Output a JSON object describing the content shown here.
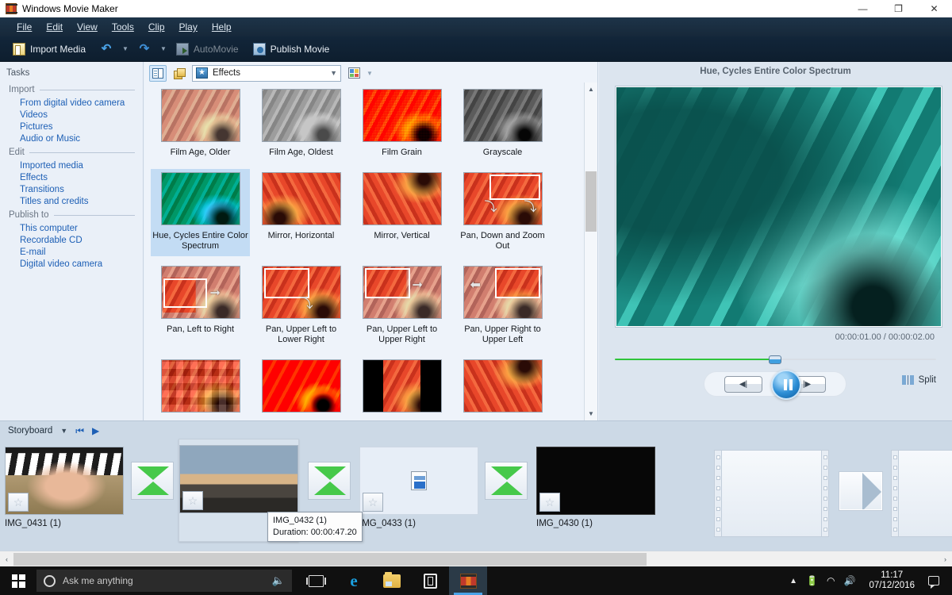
{
  "window": {
    "title": "Windows Movie Maker",
    "app_icon": "film-strip-icon",
    "minimize": "—",
    "maximize": "❐",
    "close": "✕"
  },
  "menu": {
    "items": [
      {
        "label": "File",
        "accel": "F"
      },
      {
        "label": "Edit",
        "accel": "E"
      },
      {
        "label": "View",
        "accel": "V"
      },
      {
        "label": "Tools",
        "accel": "T"
      },
      {
        "label": "Clip",
        "accel": "C"
      },
      {
        "label": "Play",
        "accel": "P"
      },
      {
        "label": "Help",
        "accel": "H"
      }
    ]
  },
  "toolbar": {
    "import_media": "Import Media",
    "undo": "↶",
    "redo": "↷",
    "automovie": "AutoMovie",
    "publish_movie": "Publish Movie"
  },
  "tasks": {
    "title": "Tasks",
    "groups": [
      {
        "heading": "Import",
        "links": [
          "From digital video camera",
          "Videos",
          "Pictures",
          "Audio or Music"
        ]
      },
      {
        "heading": "Edit",
        "links": [
          "Imported media",
          "Effects",
          "Transitions",
          "Titles and credits"
        ]
      },
      {
        "heading": "Publish to",
        "links": [
          "This computer",
          "Recordable CD",
          "E-mail",
          "Digital video camera"
        ]
      }
    ]
  },
  "effects_panel": {
    "collections_button": "collections-icon",
    "tasks_button": "tasks-pane-icon",
    "collection_selected": "Effects",
    "views_button": "views-icon",
    "items": [
      {
        "label": "Film Age, Older",
        "thumb": "fl-older",
        "selected": false
      },
      {
        "label": "Film Age, Oldest",
        "thumb": "fl-oldest",
        "selected": false
      },
      {
        "label": "Film Grain",
        "thumb": "fl-grain",
        "selected": false
      },
      {
        "label": "Grayscale",
        "thumb": "fl-gray",
        "selected": false
      },
      {
        "label": "Hue, Cycles Entire Color Spectrum",
        "thumb": "fl-hue",
        "selected": true
      },
      {
        "label": "Mirror, Horizontal",
        "thumb": "fl-mirrorh",
        "selected": false
      },
      {
        "label": "Mirror, Vertical",
        "thumb": "fl-mirrorv",
        "selected": false
      },
      {
        "label": "Pan, Down and Zoom Out",
        "thumb": "pan-down-zoom-out",
        "selected": false
      },
      {
        "label": "Pan, Left to Right",
        "thumb": "pan-left-right",
        "selected": false
      },
      {
        "label": "Pan, Upper Left to Lower Right",
        "thumb": "pan-ul-lr",
        "selected": false
      },
      {
        "label": "Pan, Upper Left to Upper Right",
        "thumb": "pan-ul-ur",
        "selected": false
      },
      {
        "label": "Pan, Upper Right to Upper Left",
        "thumb": "pan-ur-ul",
        "selected": false
      }
    ],
    "partial_row": [
      "fl-pixel",
      "fl-post",
      "fl-bars",
      "fl-base"
    ]
  },
  "preview": {
    "title": "Hue, Cycles Entire Color Spectrum",
    "timecode": "00:00:01.00 / 00:00:02.00",
    "progress_percent": 49,
    "prev_frame": "◀|",
    "play_pause": "pause-icon",
    "next_frame": "|▶",
    "split_label": "Split"
  },
  "storyboard": {
    "mode_label": "Storyboard",
    "rewind_icon": "⏮",
    "play_icon": "▶",
    "clips": [
      {
        "caption": "IMG_0431 (1)",
        "kind": "photo-upsidedown",
        "selected": false
      },
      {
        "caption": "IMG_0432 (1)",
        "kind": "photo-sunset",
        "selected": true
      },
      {
        "caption": "IMG_0433 (1)",
        "kind": "video-placeholder",
        "selected": false
      },
      {
        "caption": "IMG_0430 (1)",
        "kind": "photo-black",
        "selected": false
      }
    ],
    "tooltip": {
      "name": "IMG_0432 (1)",
      "duration": "Duration: 00:00:47.20"
    },
    "scroll_left": "‹",
    "scroll_right": "›"
  },
  "taskbar": {
    "start": "windows-logo",
    "search_placeholder": "Ask me anything",
    "mic": "microphone-icon",
    "apps": [
      "task-view-icon",
      "edge-icon",
      "file-explorer-icon",
      "store-icon",
      "movie-maker-icon"
    ],
    "tray": [
      "show-hidden-icons",
      "battery-icon",
      "wifi-icon",
      "volume-icon"
    ],
    "time": "11:17",
    "date": "07/12/2016",
    "action_center": "notification-icon"
  },
  "colors": {
    "accent_blue": "#1d5fb5",
    "menu_bar": "#1a2e41",
    "toolbar": "#0e1e2e",
    "selection": "#c3dcf4",
    "progress_green": "#2fc43a",
    "storyboard_bg": "#ccd9e6",
    "preview_teal": "#0d5f5a"
  }
}
